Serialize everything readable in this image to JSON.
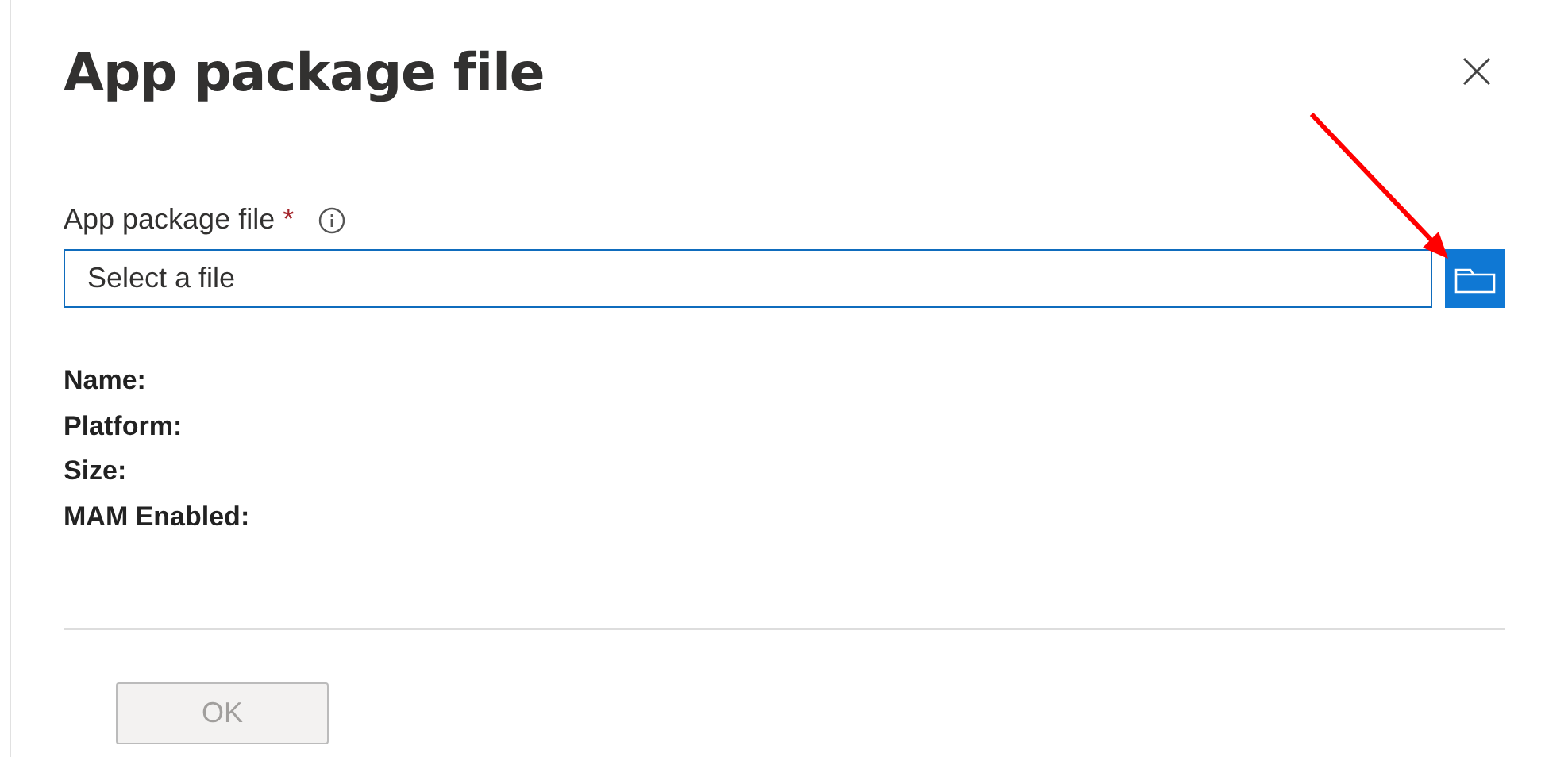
{
  "panel": {
    "title": "App package file"
  },
  "field": {
    "label": "App package file",
    "required_mark": "*",
    "placeholder": "Select a file"
  },
  "details": [
    {
      "label": "Name:"
    },
    {
      "label": "Platform:"
    },
    {
      "label": "Size:"
    },
    {
      "label": "MAM Enabled:"
    }
  ],
  "ok_button": {
    "label": "OK",
    "disabled": true
  }
}
